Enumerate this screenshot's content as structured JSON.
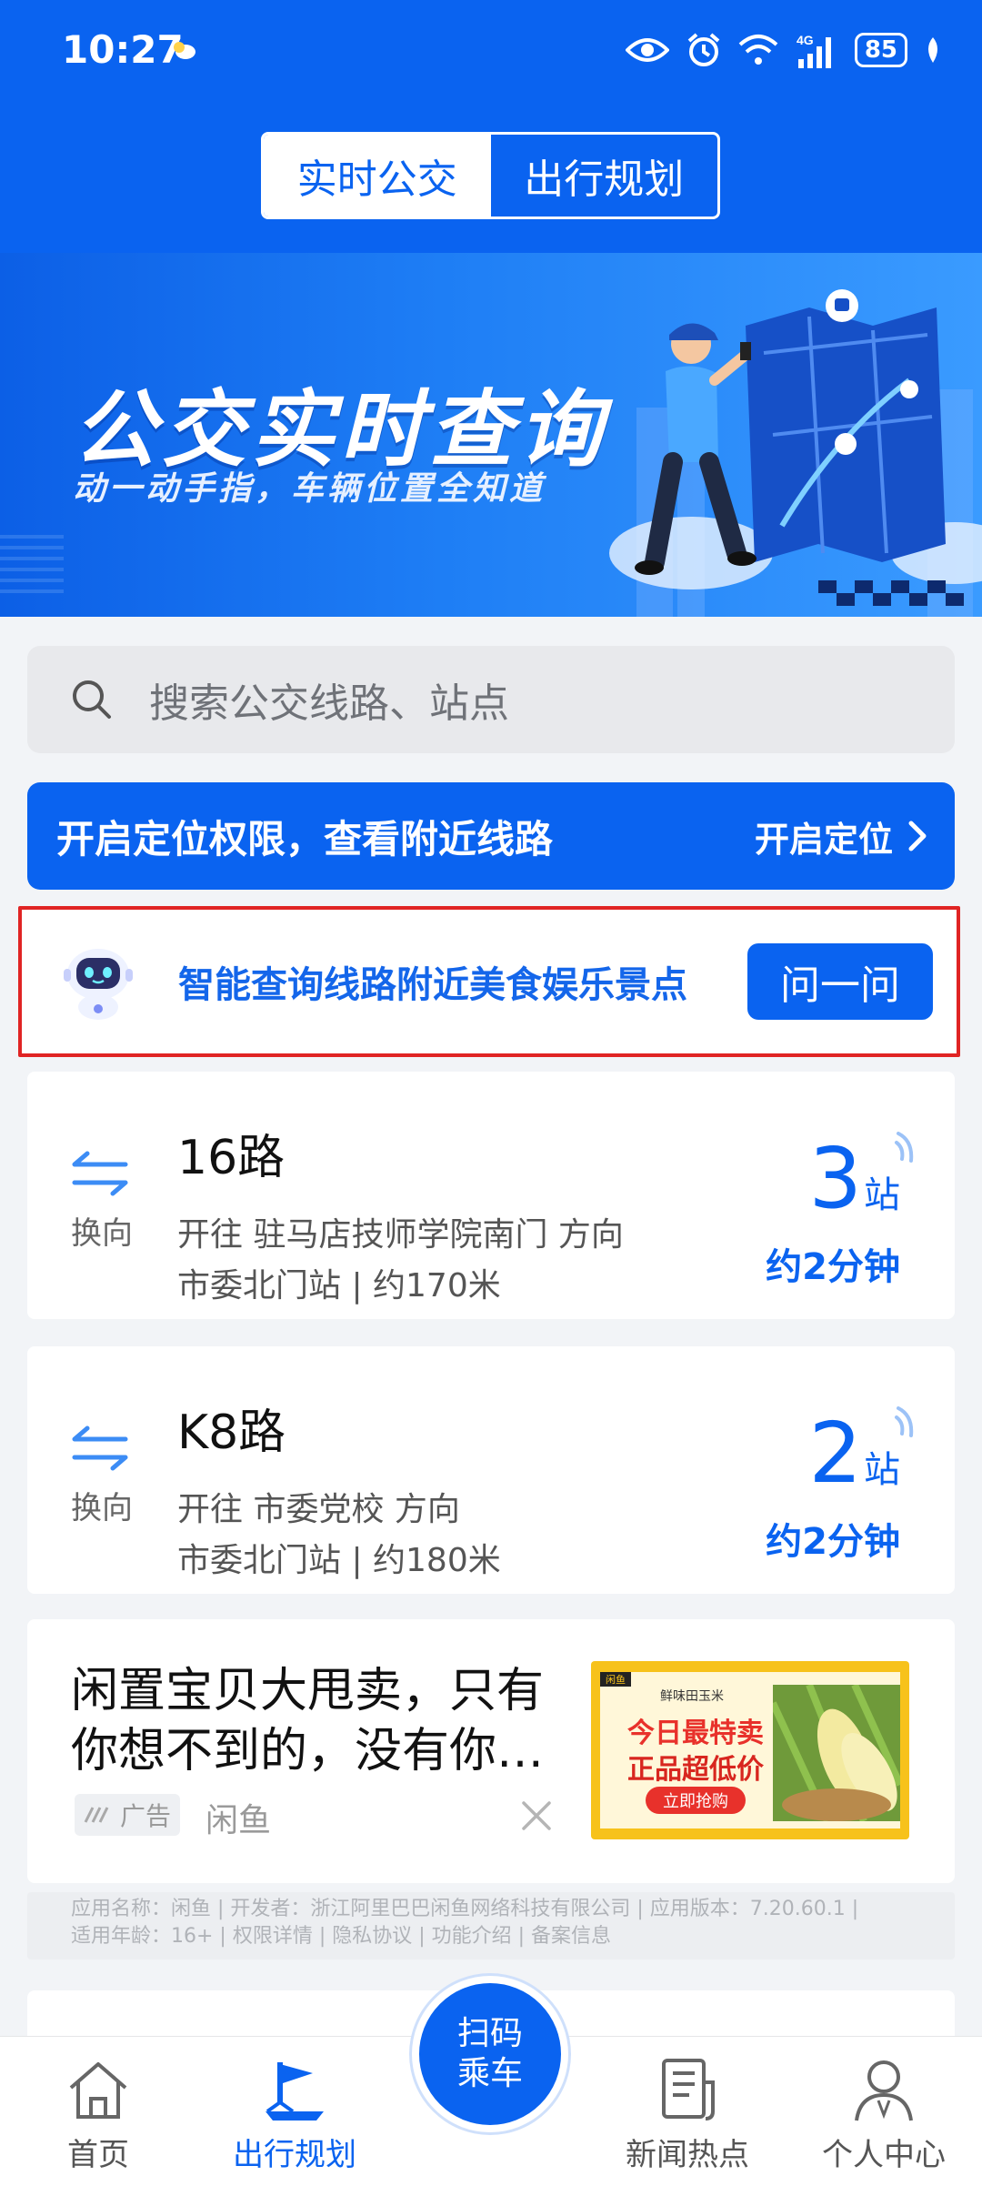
{
  "status_bar": {
    "time": "10:27",
    "network": "4G",
    "battery": "85"
  },
  "segment": {
    "tabs": [
      "实时公交",
      "出行规划"
    ]
  },
  "banner": {
    "title": "公交实时查询",
    "subtitle": "动一动手指，车辆位置全知道"
  },
  "search": {
    "placeholder": "搜索公交线路、站点"
  },
  "location": {
    "text": "开启定位权限，查看附近线路",
    "button": "开启定位"
  },
  "ai_assistant": {
    "text": "智能查询线路附近美食娱乐景点",
    "button": "问一问"
  },
  "routes": [
    {
      "name": "16路",
      "swap_label": "换向",
      "direction": "开往 驻马店技师学院南门 方向",
      "stop": "市委北门站 | 约170米",
      "stops_away": "3",
      "stops_unit": "站",
      "eta": "约2分钟"
    },
    {
      "name": "K8路",
      "swap_label": "换向",
      "direction": "开往 市委党校 方向",
      "stop": "市委北门站 | 约180米",
      "stops_away": "2",
      "stops_unit": "站",
      "eta": "约2分钟"
    }
  ],
  "ad": {
    "title": "闲置宝贝大甩卖，只有你想不到的，没有你…",
    "tag": "广告",
    "source": "闲鱼",
    "image_text": {
      "logo": "闲鱼",
      "small": "鲜味田玉米",
      "line1": "今日最特卖",
      "line2": "正品超低价",
      "button": "立即抢购"
    }
  },
  "app_info": {
    "line1": "应用名称：闲鱼 | 开发者：浙江阿里巴巴闲鱼网络科技有限公司 | 应用版本：7.20.60.1 |",
    "line2": "适用年龄：16+ | 权限详情 | 隐私协议 | 功能介绍 | 备案信息"
  },
  "tabbar": {
    "home": "首页",
    "plan": "出行规划",
    "scan_line1": "扫码",
    "scan_line2": "乘车",
    "news": "新闻热点",
    "profile": "个人中心"
  },
  "colors": {
    "primary": "#0a63f0",
    "highlight_border": "#e02424",
    "ad_yellow": "#f7c21b"
  }
}
